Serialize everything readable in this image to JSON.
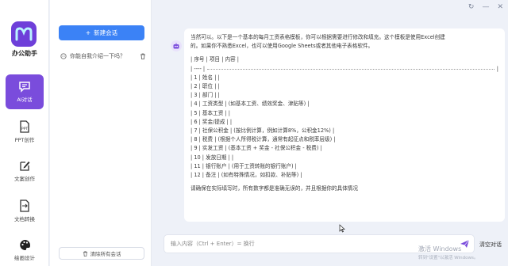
{
  "window": {
    "restore_icon": "↻",
    "minimize_icon": "—",
    "close_icon": "✕"
  },
  "app": {
    "name": "办公助手",
    "brand_color": "#6e3fd9",
    "accent": "#3b82f6"
  },
  "nav": [
    {
      "label": "AI对话",
      "icon": "chat-icon",
      "active": true
    },
    {
      "label": "PPT创作",
      "icon": "ppt-icon",
      "active": false
    },
    {
      "label": "文案创作",
      "icon": "edit-icon",
      "active": false
    },
    {
      "label": "文档转换",
      "icon": "document-convert-icon",
      "active": false
    },
    {
      "label": "绘画设计",
      "icon": "palette-icon",
      "active": false
    }
  ],
  "conversations": {
    "new_chat_label": "新建会话",
    "items": [
      {
        "title": "你能自我介绍一下吗？"
      }
    ],
    "clear_label": "清除所有会话"
  },
  "message": {
    "intro1": "当然可以。以下是一个基本的每月工资表格模板，你可以根据需要进行修改和填充。这个模板是使用Excel创建",
    "intro2": "的。如果你不熟悉Excel，也可以使用Google Sheets或者其他电子表格软件。",
    "header": "| 序号 | 项目 | 内容 |",
    "ruler_start": "| ---- |",
    "ruler_end": "|",
    "rows": [
      "| 1 | 姓名 | |",
      "| 2 | 职位 | |",
      "| 3 | 部门 | |",
      "| 4 | 工资类型 | (如基本工资、绩效奖金、津贴等) |",
      "| 5 | 基本工资 | |",
      "| 6 | 奖金/提成 | |",
      "| 7 | 社保公积金 | (按比例计算，例如计算8%，公积金12%) |",
      "| 8 | 税费 | (根据个人所得税计算，通常有起征点和税率层级) |",
      "| 9 | 实发工资 | (基本工资 + 奖金 - 社保公积金 - 税费) |",
      "| 10 | 发放日期 | |",
      "| 11 | 银行账户 | (用于工资转账的银行账户) |",
      "| 12 | 备注 | (如有特殊情况，如扣款、补贴等) |"
    ],
    "closing": "请确保在实际填写时，所有数字都是准确无误的，并且根据你的具体情况"
  },
  "composer": {
    "placeholder": "输入内容（Ctrl + Enter）= 换行",
    "clear_context_label": "清空对话"
  },
  "watermark": {
    "line1": "激活 Windows",
    "line2": "转到\"设置\"以激活 Windows。"
  }
}
